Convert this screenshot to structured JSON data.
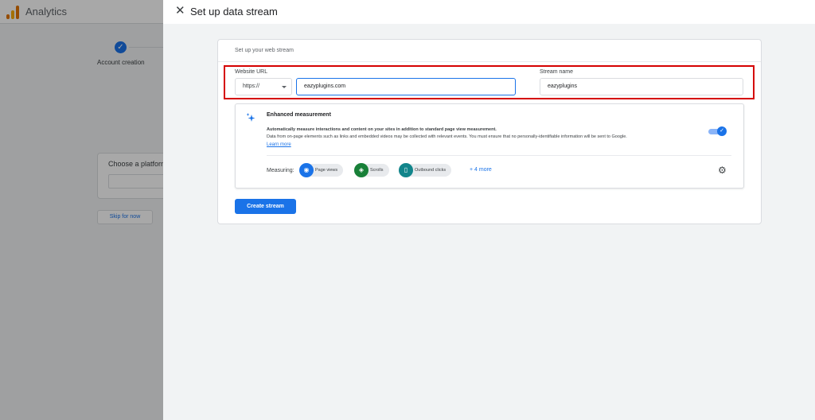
{
  "app": {
    "title": "Analytics"
  },
  "background": {
    "step_label": "Account creation",
    "platform_title": "Choose a platform",
    "skip_label": "Skip for now"
  },
  "drawer": {
    "title": "Set up data stream"
  },
  "stream_form": {
    "heading": "Set up your web stream",
    "website_url_label": "Website URL",
    "protocol": "https://",
    "url_value": "eazyplugins.com",
    "stream_name_label": "Stream name",
    "stream_name_value": "eazyplugins"
  },
  "enhanced_measurement": {
    "title": "Enhanced measurement",
    "description_bold": "Automatically measure interactions and content on your sites in addition to standard page view measurement.",
    "description": "Data from on-page elements such as links and embedded videos may be collected with relevant events. You must ensure that no personally-identifiable information will be sent to Google.",
    "learn_more": "Learn more",
    "enabled": true,
    "measuring_label": "Measuring:",
    "chips": [
      {
        "label": "Page views",
        "icon": "eye-icon",
        "color": "#1a73e8"
      },
      {
        "label": "Scrolls",
        "icon": "scroll-icon",
        "color": "#188038"
      },
      {
        "label": "Outbound clicks",
        "icon": "mouse-icon",
        "color": "#12858b"
      }
    ],
    "more_link": "+ 4 more"
  },
  "create_button": "Create stream",
  "colors": {
    "accent": "#1a73e8",
    "highlight": "#d50000"
  }
}
